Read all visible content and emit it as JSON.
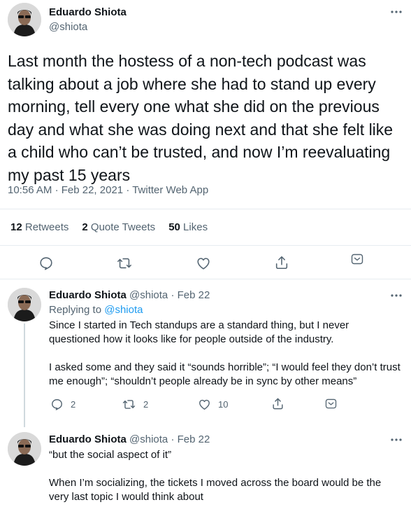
{
  "main_tweet": {
    "author_name": "Eduardo Shiota",
    "author_handle": "@shiota",
    "text": "Last month the hostess of a non-tech podcast was talking about a job where she had to stand up every morning, tell every one what she did on the previous day and what she was doing next and that she felt like a child who can’t be trusted, and now I’m reevaluating my past 15 years",
    "time": "10:56 AM",
    "date": "Feb 22, 2021",
    "source": "Twitter Web App",
    "stats": {
      "retweets_count": "12",
      "retweets_label": "Retweets",
      "quotes_count": "2",
      "quotes_label": "Quote Tweets",
      "likes_count": "50",
      "likes_label": "Likes"
    }
  },
  "replies": [
    {
      "author_name": "Eduardo Shiota",
      "author_handle": "@shiota",
      "date": "Feb 22",
      "replying_to_label": "Replying to",
      "replying_to_handle": "@shiota",
      "paragraphs": [
        "Since I started in Tech standups are a standard thing, but I never questioned how it looks like for people outside of the industry.",
        "I asked some and they said it “sounds horrible”; “I would feel they don’t trust me enough”; “shouldn’t people already be in sync by other means”"
      ],
      "reply_count": "2",
      "retweet_count": "2",
      "like_count": "10"
    },
    {
      "author_name": "Eduardo Shiota",
      "author_handle": "@shiota",
      "date": "Feb 22",
      "paragraphs": [
        "“but the social aspect of it”",
        "When I’m socializing, the tickets I moved across the board would be the very last topic I would think about"
      ]
    }
  ],
  "separator": "·",
  "icons": [
    "more-icon",
    "reply-icon",
    "retweet-icon",
    "like-icon",
    "share-icon",
    "tip-icon"
  ],
  "colors": {
    "text": "#0f1419",
    "muted": "#536471",
    "link": "#1d9bf0",
    "divider": "#e6ecf0"
  }
}
